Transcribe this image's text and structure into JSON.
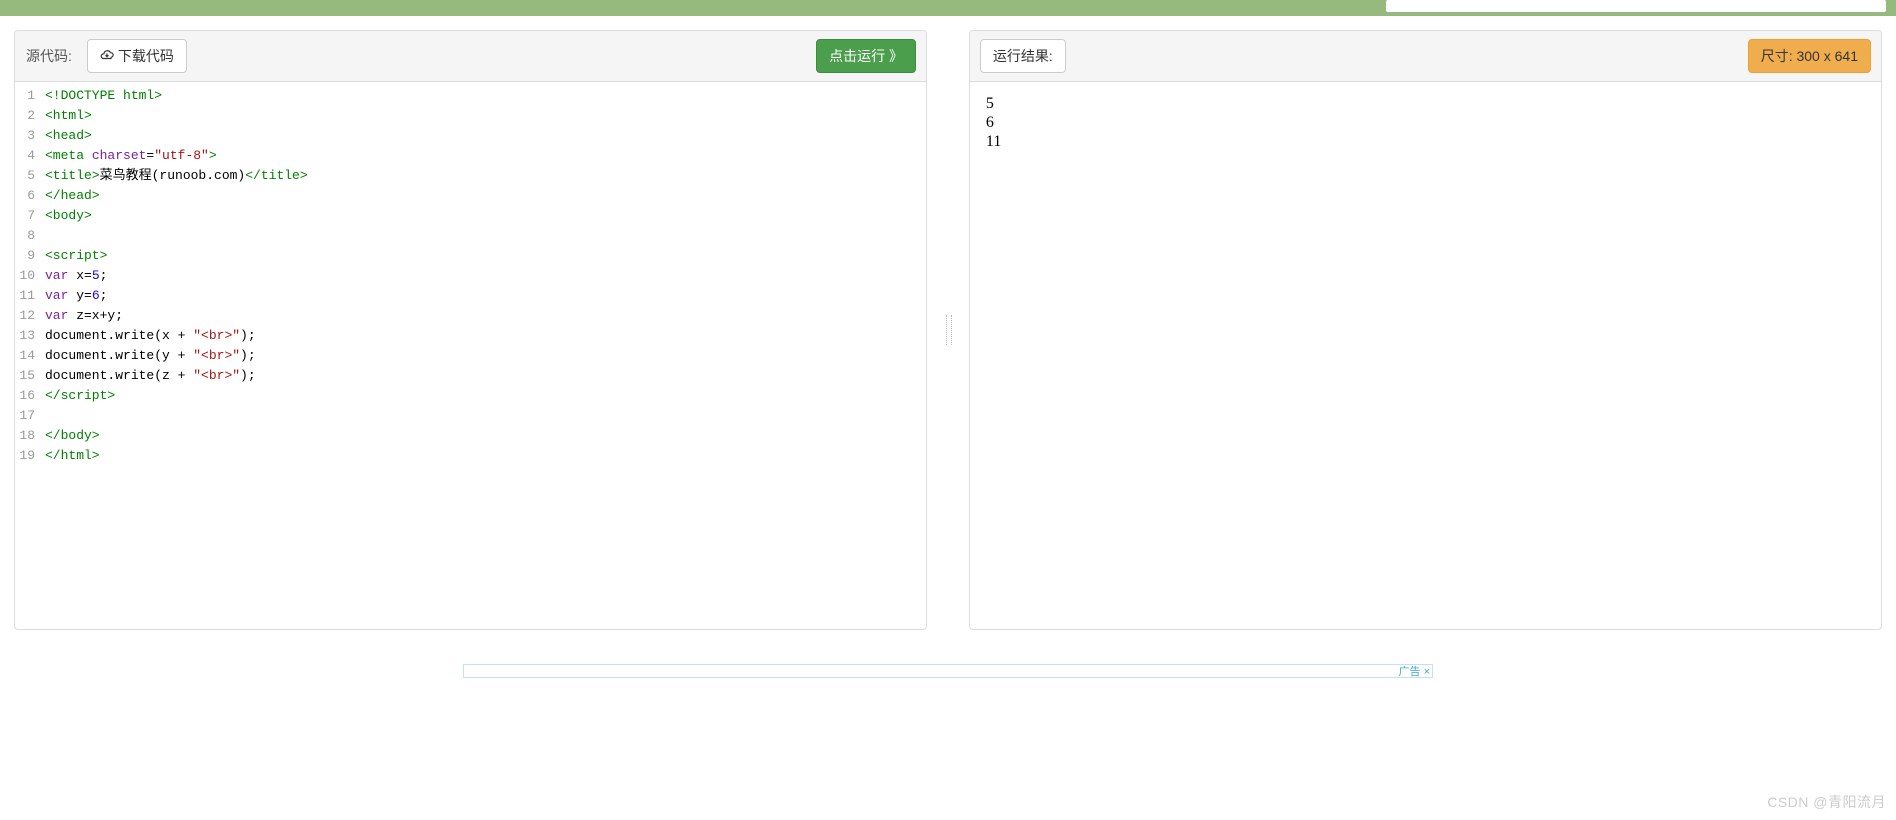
{
  "topbar": {},
  "left_panel": {
    "source_label": "源代码:",
    "download_label": "下载代码",
    "run_label": "点击运行 》"
  },
  "right_panel": {
    "result_label": "运行结果:",
    "size_label": "尺寸: 300 x 641"
  },
  "code": {
    "line_numbers": [
      "1",
      "2",
      "3",
      "4",
      "5",
      "6",
      "7",
      "8",
      "9",
      "10",
      "11",
      "12",
      "13",
      "14",
      "15",
      "16",
      "17",
      "18",
      "19"
    ],
    "lines": [
      [
        {
          "t": "tag",
          "v": "<!DOCTYPE html>"
        }
      ],
      [
        {
          "t": "tag",
          "v": "<html>"
        }
      ],
      [
        {
          "t": "tag",
          "v": "<head>"
        }
      ],
      [
        {
          "t": "tag",
          "v": "<meta "
        },
        {
          "t": "attr",
          "v": "charset"
        },
        {
          "t": "text",
          "v": "="
        },
        {
          "t": "str",
          "v": "\"utf-8\""
        },
        {
          "t": "tag",
          "v": ">"
        }
      ],
      [
        {
          "t": "tag",
          "v": "<title>"
        },
        {
          "t": "text",
          "v": "菜鸟教程(runoob.com)"
        },
        {
          "t": "tag",
          "v": "</title>"
        }
      ],
      [
        {
          "t": "tag",
          "v": "</head>"
        }
      ],
      [
        {
          "t": "tag",
          "v": "<body>"
        }
      ],
      [
        {
          "t": "text",
          "v": ""
        }
      ],
      [
        {
          "t": "tag",
          "v": "<script>"
        }
      ],
      [
        {
          "t": "kw",
          "v": "var"
        },
        {
          "t": "text",
          "v": " x="
        },
        {
          "t": "num",
          "v": "5"
        },
        {
          "t": "text",
          "v": ";"
        }
      ],
      [
        {
          "t": "kw",
          "v": "var"
        },
        {
          "t": "text",
          "v": " y="
        },
        {
          "t": "num",
          "v": "6"
        },
        {
          "t": "text",
          "v": ";"
        }
      ],
      [
        {
          "t": "kw",
          "v": "var"
        },
        {
          "t": "text",
          "v": " z=x+y;"
        }
      ],
      [
        {
          "t": "text",
          "v": "document.write(x + "
        },
        {
          "t": "str",
          "v": "\"<br>\""
        },
        {
          "t": "text",
          "v": ");"
        }
      ],
      [
        {
          "t": "text",
          "v": "document.write(y + "
        },
        {
          "t": "str",
          "v": "\"<br>\""
        },
        {
          "t": "text",
          "v": ");"
        }
      ],
      [
        {
          "t": "text",
          "v": "document.write(z + "
        },
        {
          "t": "str",
          "v": "\"<br>\""
        },
        {
          "t": "text",
          "v": ");"
        }
      ],
      [
        {
          "t": "tag",
          "v": "</script>"
        }
      ],
      [
        {
          "t": "text",
          "v": ""
        }
      ],
      [
        {
          "t": "tag",
          "v": "</body>"
        }
      ],
      [
        {
          "t": "tag",
          "v": "</html>"
        }
      ]
    ]
  },
  "output": [
    "5",
    "6",
    "11"
  ],
  "ad": {
    "label": "广告",
    "close": "×"
  },
  "watermark": "CSDN @青阳流月"
}
